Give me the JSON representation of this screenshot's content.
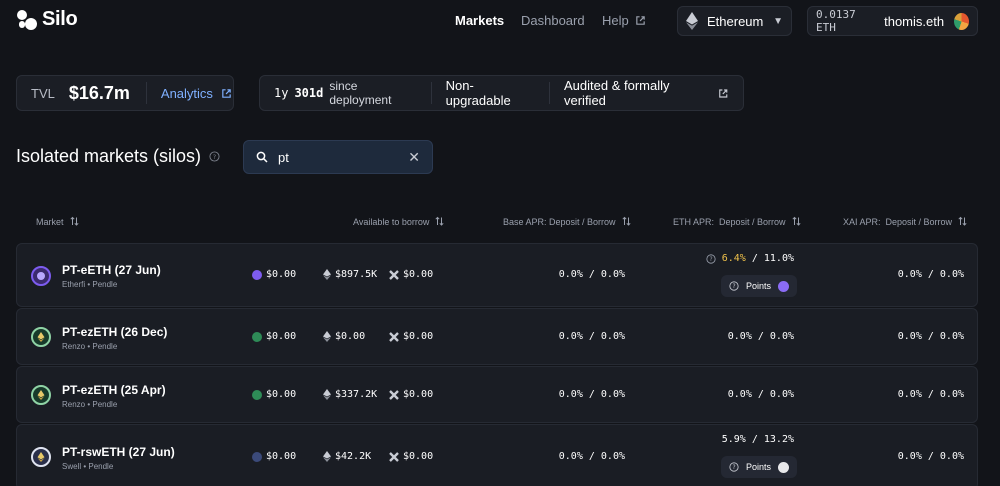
{
  "header": {
    "logo_text": "Silo",
    "nav": {
      "markets": "Markets",
      "dashboard": "Dashboard",
      "help": "Help"
    },
    "network": "Ethereum",
    "wallet": {
      "balance": "0.0137 ETH",
      "name": "thomis.eth"
    }
  },
  "stats": {
    "tvl_label": "TVL",
    "tvl_value": "$16.7m",
    "analytics": "Analytics",
    "deploy_duration_1": "1y",
    "deploy_duration_2": "301d",
    "deploy_suffix": "since deployment",
    "upgradable": "Non-upgradable",
    "audited": "Audited & formally verified"
  },
  "section": {
    "title": "Isolated markets (silos)",
    "search_value": "pt"
  },
  "table": {
    "headers": {
      "market": "Market",
      "available": "Available to borrow",
      "base_apr": "Base APR: Deposit / Borrow",
      "eth_apr": "ETH APR:  Deposit / Borrow",
      "xai_apr": "XAI APR:  Deposit / Borrow"
    },
    "rows": [
      {
        "name": "PT-eETH (27 Jun)",
        "sub": "Etherfi • Pendle",
        "token_avail": "$0.00",
        "eth_avail": "$897.5K",
        "xai_avail": "$0.00",
        "base_apr": "0.0% / 0.0%",
        "eth_apr_deposit": "6.4%",
        "eth_apr_borrow": " / 11.0%",
        "points": "Points",
        "xai_apr": "0.0% / 0.0%"
      },
      {
        "name": "PT-ezETH (26 Dec)",
        "sub": "Renzo • Pendle",
        "token_avail": "$0.00",
        "eth_avail": "$0.00",
        "xai_avail": "$0.00",
        "base_apr": "0.0% / 0.0%",
        "eth_apr": "0.0% / 0.0%",
        "xai_apr": "0.0% / 0.0%"
      },
      {
        "name": "PT-ezETH (25 Apr)",
        "sub": "Renzo • Pendle",
        "token_avail": "$0.00",
        "eth_avail": "$337.2K",
        "xai_avail": "$0.00",
        "base_apr": "0.0% / 0.0%",
        "eth_apr": "0.0% / 0.0%",
        "xai_apr": "0.0% / 0.0%"
      },
      {
        "name": "PT-rswETH (27 Jun)",
        "sub": "Swell • Pendle",
        "token_avail": "$0.00",
        "eth_avail": "$42.2K",
        "xai_avail": "$0.00",
        "base_apr": "0.0% / 0.0%",
        "eth_apr": "5.9% / 13.2%",
        "points": "Points",
        "xai_apr": "0.0% / 0.0%"
      }
    ]
  },
  "colors": {
    "background": "#121419",
    "panel": "#1b1e25",
    "accent_link": "#7fb0ff",
    "highlight": "#f0c24b"
  },
  "icons": [
    "silo-logo-icon",
    "external-link-icon",
    "ethereum-icon",
    "chevron-down-icon",
    "info-icon",
    "search-icon",
    "close-icon",
    "sort-icon",
    "x-token-icon"
  ]
}
